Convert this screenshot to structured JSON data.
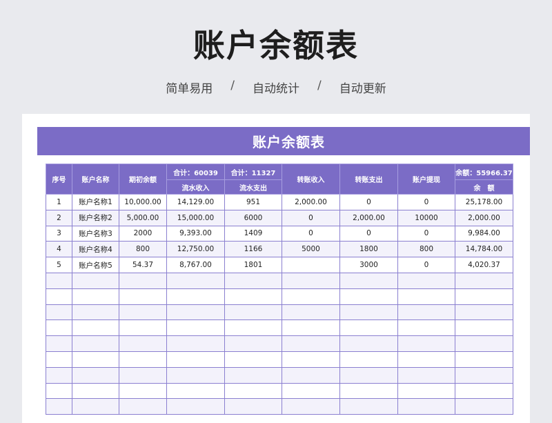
{
  "title": "账户余额表",
  "subtitle": {
    "items": [
      "简单易用",
      "自动统计",
      "自动更新"
    ],
    "separator": "/"
  },
  "sheet": {
    "banner": "账户余额表",
    "accent_color": "#7b6cc6",
    "headers": {
      "seq": "序号",
      "name": "账户名称",
      "opening": "期初余额",
      "inflow_total": "合计：60039",
      "inflow": "流水收入",
      "outflow_total": "合计：11327",
      "outflow": "流水支出",
      "transfer_in": "转账收入",
      "transfer_out": "转账支出",
      "withdraw": "账户提现",
      "balance_total": "余额：55966.37",
      "balance": "余　额"
    },
    "rows": [
      {
        "seq": "1",
        "name": "账户名称1",
        "opening": "10,000.00",
        "inflow": "14,129.00",
        "outflow": "951",
        "transfer_in": "2,000.00",
        "transfer_out": "0",
        "withdraw": "0",
        "balance": "25,178.00"
      },
      {
        "seq": "2",
        "name": "账户名称2",
        "opening": "5,000.00",
        "inflow": "15,000.00",
        "outflow": "6000",
        "transfer_in": "0",
        "transfer_out": "2,000.00",
        "withdraw": "10000",
        "balance": "2,000.00"
      },
      {
        "seq": "3",
        "name": "账户名称3",
        "opening": "2000",
        "inflow": "9,393.00",
        "outflow": "1409",
        "transfer_in": "0",
        "transfer_out": "0",
        "withdraw": "0",
        "balance": "9,984.00"
      },
      {
        "seq": "4",
        "name": "账户名称4",
        "opening": "800",
        "inflow": "12,750.00",
        "outflow": "1166",
        "transfer_in": "5000",
        "transfer_out": "1800",
        "withdraw": "800",
        "balance": "14,784.00"
      },
      {
        "seq": "5",
        "name": "账户名称5",
        "opening": "54.37",
        "inflow": "8,767.00",
        "outflow": "1801",
        "transfer_in": "",
        "transfer_out": "3000",
        "withdraw": "0",
        "balance": "4,020.37"
      }
    ]
  }
}
